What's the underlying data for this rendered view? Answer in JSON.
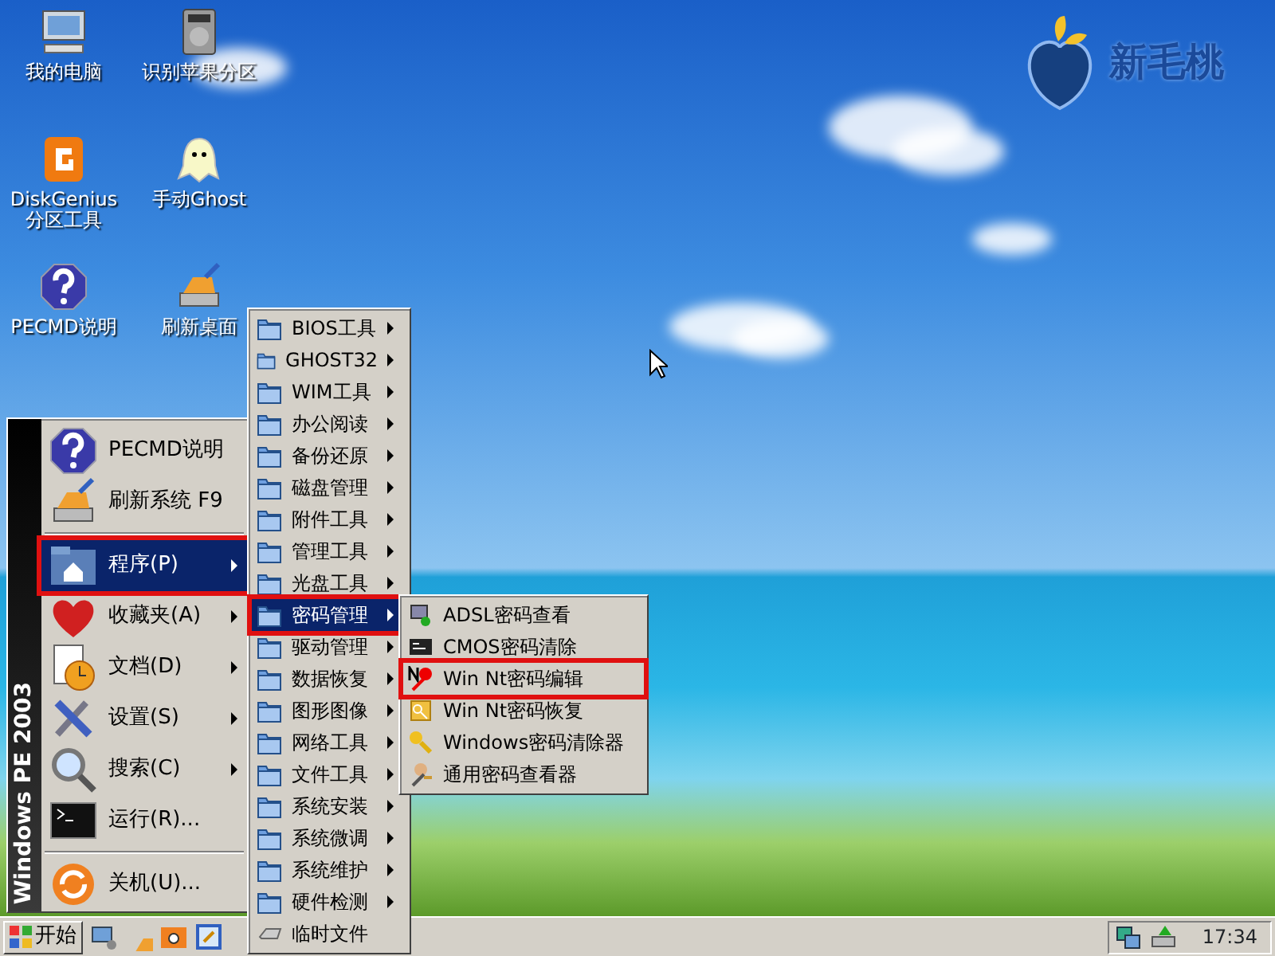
{
  "desktop": {
    "logo": {
      "text": "新毛桃"
    },
    "icons": [
      {
        "label": "我的电脑"
      },
      {
        "label": "识别苹果分区"
      },
      {
        "label": "DiskGenius分区工具"
      },
      {
        "label": "手动Ghost"
      },
      {
        "label": "PECMD说明"
      },
      {
        "label": "刷新桌面"
      }
    ]
  },
  "start_menu": {
    "banner": "Windows PE 2003",
    "items": [
      {
        "kind": "item",
        "label": "PECMD说明",
        "submenu": false,
        "selected": false,
        "highlighted": false
      },
      {
        "kind": "item",
        "label": "刷新系统 F9",
        "submenu": false,
        "selected": false,
        "highlighted": false
      },
      {
        "kind": "separator"
      },
      {
        "kind": "item",
        "label": "程序(P)",
        "submenu": true,
        "selected": true,
        "highlighted": true
      },
      {
        "kind": "item",
        "label": "收藏夹(A)",
        "submenu": true,
        "selected": false,
        "highlighted": false
      },
      {
        "kind": "item",
        "label": "文档(D)",
        "submenu": true,
        "selected": false,
        "highlighted": false
      },
      {
        "kind": "item",
        "label": "设置(S)",
        "submenu": true,
        "selected": false,
        "highlighted": false
      },
      {
        "kind": "item",
        "label": "搜索(C)",
        "submenu": true,
        "selected": false,
        "highlighted": false
      },
      {
        "kind": "item",
        "label": "运行(R)...",
        "submenu": false,
        "selected": false,
        "highlighted": false
      },
      {
        "kind": "separator"
      },
      {
        "kind": "item",
        "label": "关机(U)...",
        "submenu": false,
        "selected": false,
        "highlighted": false
      }
    ]
  },
  "programs_menu": {
    "items": [
      {
        "label": "BIOS工具",
        "submenu": true,
        "selected": false,
        "highlighted": false
      },
      {
        "label": "GHOST32",
        "submenu": true,
        "selected": false,
        "highlighted": false
      },
      {
        "label": "WIM工具",
        "submenu": true,
        "selected": false,
        "highlighted": false
      },
      {
        "label": "办公阅读",
        "submenu": true,
        "selected": false,
        "highlighted": false
      },
      {
        "label": "备份还原",
        "submenu": true,
        "selected": false,
        "highlighted": false
      },
      {
        "label": "磁盘管理",
        "submenu": true,
        "selected": false,
        "highlighted": false
      },
      {
        "label": "附件工具",
        "submenu": true,
        "selected": false,
        "highlighted": false
      },
      {
        "label": "管理工具",
        "submenu": true,
        "selected": false,
        "highlighted": false
      },
      {
        "label": "光盘工具",
        "submenu": true,
        "selected": false,
        "highlighted": false
      },
      {
        "label": "密码管理",
        "submenu": true,
        "selected": true,
        "highlighted": true
      },
      {
        "label": "驱动管理",
        "submenu": true,
        "selected": false,
        "highlighted": false
      },
      {
        "label": "数据恢复",
        "submenu": true,
        "selected": false,
        "highlighted": false
      },
      {
        "label": "图形图像",
        "submenu": true,
        "selected": false,
        "highlighted": false
      },
      {
        "label": "网络工具",
        "submenu": true,
        "selected": false,
        "highlighted": false
      },
      {
        "label": "文件工具",
        "submenu": true,
        "selected": false,
        "highlighted": false
      },
      {
        "label": "系统安装",
        "submenu": true,
        "selected": false,
        "highlighted": false
      },
      {
        "label": "系统微调",
        "submenu": true,
        "selected": false,
        "highlighted": false
      },
      {
        "label": "系统维护",
        "submenu": true,
        "selected": false,
        "highlighted": false
      },
      {
        "label": "硬件检测",
        "submenu": true,
        "selected": false,
        "highlighted": false
      },
      {
        "label": "临时文件",
        "submenu": false,
        "selected": false,
        "highlighted": false
      }
    ]
  },
  "password_menu": {
    "items": [
      {
        "label": "ADSL密码查看",
        "highlighted": false
      },
      {
        "label": "CMOS密码清除",
        "highlighted": false
      },
      {
        "label": "Win Nt密码编辑",
        "highlighted": true
      },
      {
        "label": "Win Nt密码恢复",
        "highlighted": false
      },
      {
        "label": "Windows密码清除器",
        "highlighted": false
      },
      {
        "label": "通用密码查看器",
        "highlighted": false
      }
    ]
  },
  "taskbar": {
    "start_button": "开始",
    "clock": "17:34"
  }
}
